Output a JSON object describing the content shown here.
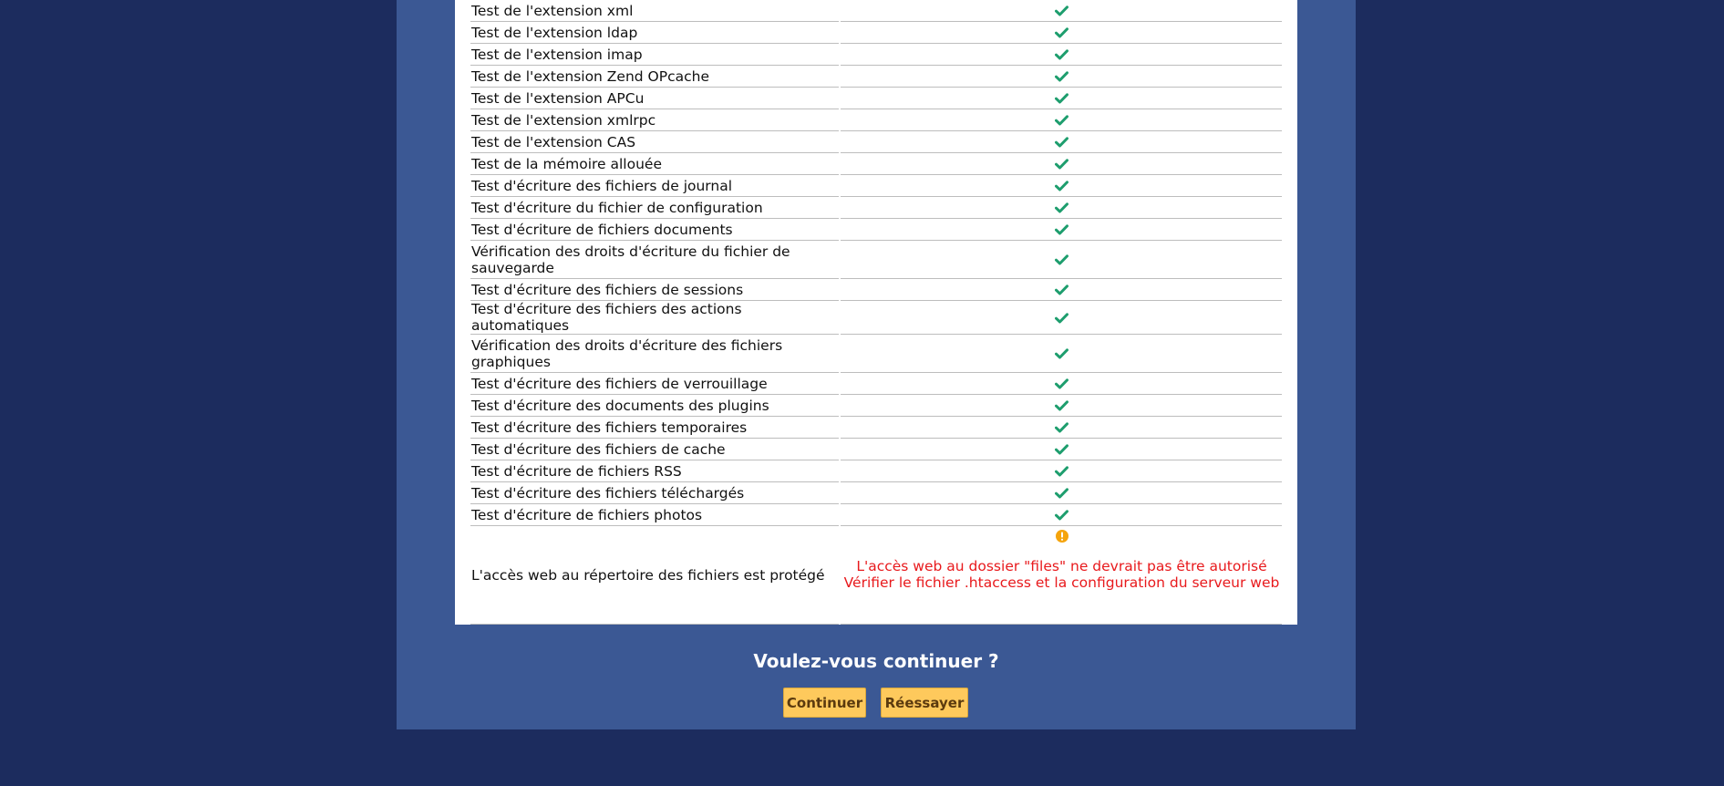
{
  "checks": [
    {
      "label": "Test de l'extension xml",
      "status": "ok"
    },
    {
      "label": "Test de l'extension ldap",
      "status": "ok"
    },
    {
      "label": "Test de l'extension imap",
      "status": "ok"
    },
    {
      "label": "Test de l'extension Zend OPcache",
      "status": "ok"
    },
    {
      "label": "Test de l'extension APCu",
      "status": "ok"
    },
    {
      "label": "Test de l'extension xmlrpc",
      "status": "ok"
    },
    {
      "label": "Test de l'extension CAS",
      "status": "ok"
    },
    {
      "label": "Test de la mémoire allouée",
      "status": "ok"
    },
    {
      "label": "Test d'écriture des fichiers de journal",
      "status": "ok"
    },
    {
      "label": "Test d'écriture du fichier de configuration",
      "status": "ok"
    },
    {
      "label": "Test d'écriture de fichiers documents",
      "status": "ok"
    },
    {
      "label": "Vérification des droits d'écriture du fichier de sauvegarde",
      "status": "ok"
    },
    {
      "label": "Test d'écriture des fichiers de sessions",
      "status": "ok"
    },
    {
      "label": "Test d'écriture des fichiers des actions automatiques",
      "status": "ok"
    },
    {
      "label": "Vérification des droits d'écriture des fichiers graphiques",
      "status": "ok"
    },
    {
      "label": "Test d'écriture des fichiers de verrouillage",
      "status": "ok"
    },
    {
      "label": "Test d'écriture des documents des plugins",
      "status": "ok"
    },
    {
      "label": "Test d'écriture des fichiers temporaires",
      "status": "ok"
    },
    {
      "label": "Test d'écriture des fichiers de cache",
      "status": "ok"
    },
    {
      "label": "Test d'écriture de fichiers RSS",
      "status": "ok"
    },
    {
      "label": "Test d'écriture des fichiers téléchargés",
      "status": "ok"
    },
    {
      "label": "Test d'écriture de fichiers photos",
      "status": "ok"
    }
  ],
  "warning_check": {
    "label": "L'accès web au répertoire des fichiers est protégé",
    "status": "warning",
    "message_line1": "L'accès web au dossier \"files\" ne devrait pas être autorisé",
    "message_line2": "Vérifier le fichier .htaccess et la configuration du serveur web"
  },
  "question": "Voulez-vous continuer ?",
  "buttons": {
    "continue_label": "Continuer",
    "retry_label": "Réessayer"
  },
  "colors": {
    "page_background": "#1c2c5e",
    "frame_background": "#3b5894",
    "ok_icon": "#1e9e6e",
    "warning_icon": "#f5a40c",
    "warning_text": "#e8191c",
    "button": "#fec95c"
  },
  "icons": {
    "ok": "check-icon",
    "warning": "exclamation-circle-icon"
  }
}
